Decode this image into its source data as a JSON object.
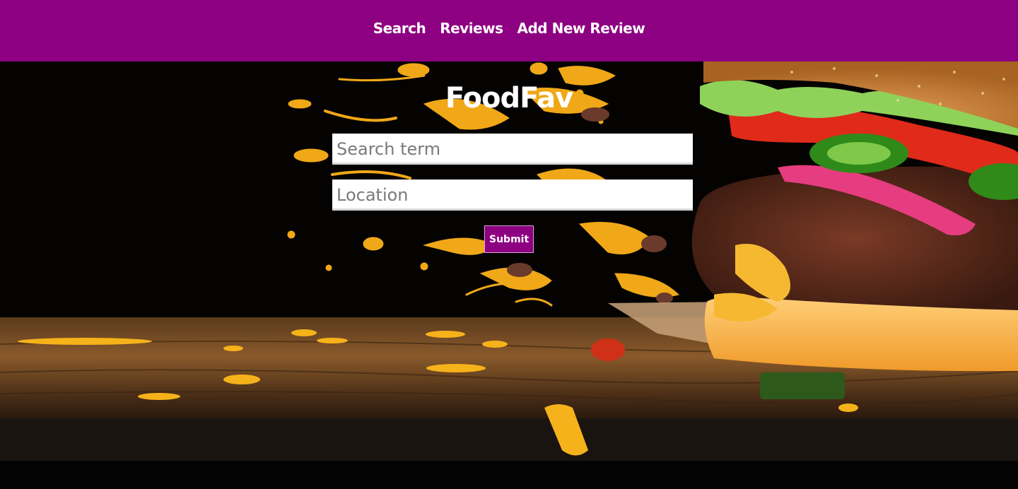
{
  "nav": {
    "items": [
      {
        "label": "Search"
      },
      {
        "label": "Reviews"
      },
      {
        "label": "Add New Review"
      }
    ]
  },
  "app": {
    "title": "FoodFav"
  },
  "form": {
    "search_placeholder": "Search term",
    "location_placeholder": "Location",
    "submit_label": "Submit"
  },
  "colors": {
    "brand": "#8d0081",
    "background": "#020202"
  }
}
